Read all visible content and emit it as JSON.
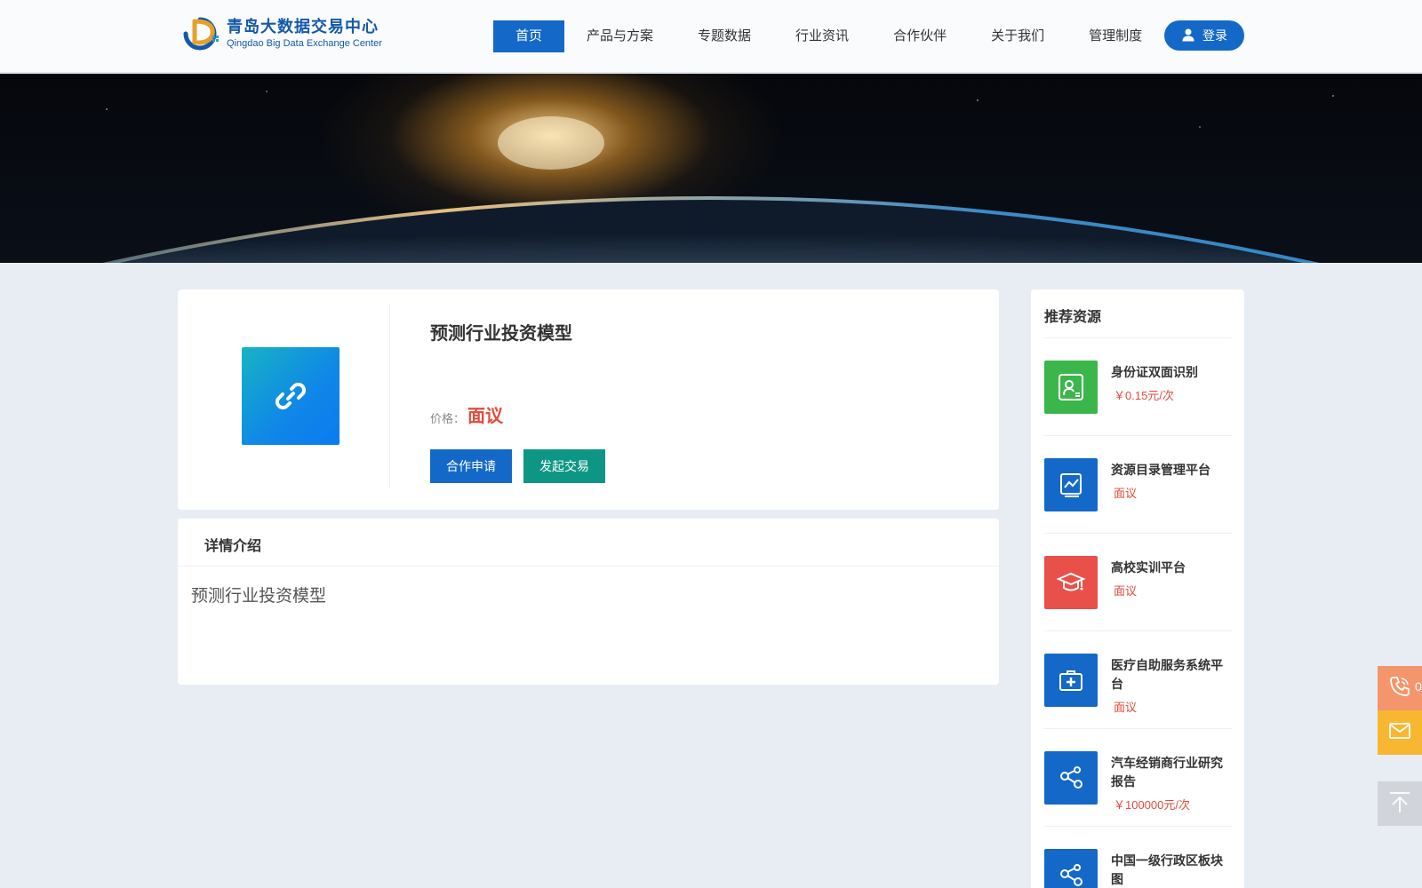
{
  "header": {
    "logo_cn": "青岛大数据交易中心",
    "logo_en": "Qingdao Big Data Exchange Center",
    "nav": [
      "首页",
      "产品与方案",
      "专题数据",
      "行业资讯",
      "合作伙伴",
      "关于我们",
      "管理制度"
    ],
    "login": "登录"
  },
  "product": {
    "title": "预测行业投资模型",
    "price_label": "价格：",
    "price_value": "面议",
    "btn_apply": "合作申请",
    "btn_trade": "发起交易"
  },
  "detail": {
    "heading": "详情介绍",
    "body": "预测行业投资模型"
  },
  "sidebar": {
    "title": "推荐资源",
    "items": [
      {
        "name": "身份证双面识别",
        "price": "￥0.15元/次",
        "color": "#3bb64b",
        "icon": "id-card-icon"
      },
      {
        "name": "资源目录管理平台",
        "price": "面议",
        "color": "#1469c8",
        "icon": "chart-doc-icon"
      },
      {
        "name": "高校实训平台",
        "price": "面议",
        "color": "#e9504a",
        "icon": "graduation-cap-icon"
      },
      {
        "name": "医疗自助服务系统平台",
        "price": "面议",
        "color": "#1469c8",
        "icon": "medical-kit-icon"
      },
      {
        "name": "汽车经销商行业研究报告",
        "price": "￥100000元/次",
        "color": "#1469c8",
        "icon": "network-nodes-icon"
      },
      {
        "name": "中国一级行政区板块图",
        "price": "",
        "color": "#1469c8",
        "icon": "network-nodes-icon"
      }
    ]
  },
  "floating": {
    "phone_text": "0"
  }
}
